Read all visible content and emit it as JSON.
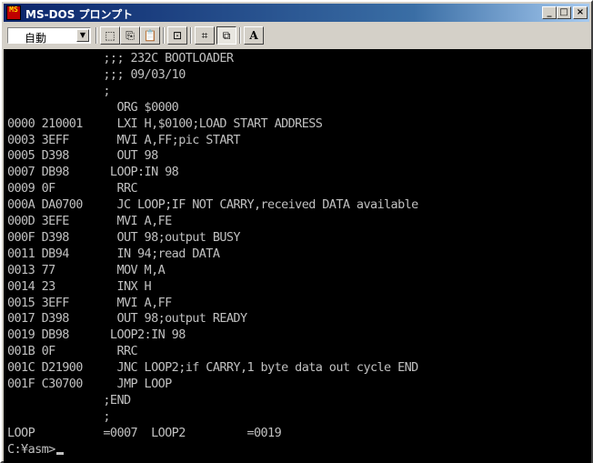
{
  "window": {
    "title": "MS-DOS プロンプト",
    "icon_text": "MS",
    "controls": {
      "minimize": "_",
      "maximize": "□",
      "close": "×"
    }
  },
  "toolbar": {
    "font_select_value": "自動",
    "font_select_arrow": "▼",
    "tools": [
      {
        "name": "mark-tool-icon",
        "glyph": "⬚"
      },
      {
        "name": "copy-tool-icon",
        "glyph": "⎘"
      },
      {
        "name": "paste-tool-icon",
        "glyph": "📋"
      },
      {
        "name": "fullscreen-tool-icon",
        "glyph": "⊡"
      },
      {
        "name": "properties-tool-icon",
        "glyph": "⌗"
      },
      {
        "name": "background-tool-icon",
        "glyph": "⧉"
      },
      {
        "name": "font-tool-icon",
        "glyph": "A"
      }
    ]
  },
  "console": {
    "lines": [
      "              ;;; 232C BOOTLOADER",
      "              ;;; 09/03/10",
      "              ;",
      "                ORG $0000",
      "0000 210001     LXI H,$0100;LOAD START ADDRESS",
      "0003 3EFF       MVI A,FF;pic START",
      "0005 D398       OUT 98",
      "0007 DB98      LOOP:IN 98",
      "0009 0F         RRC",
      "000A DA0700     JC LOOP;IF NOT CARRY,received DATA available",
      "000D 3EFE       MVI A,FE",
      "000F D398       OUT 98;output BUSY",
      "0011 DB94       IN 94;read DATA",
      "0013 77         MOV M,A",
      "0014 23         INX H",
      "0015 3EFF       MVI A,FF",
      "0017 D398       OUT 98;output READY",
      "0019 DB98      LOOP2:IN 98",
      "001B 0F         RRC",
      "001C D21900     JNC LOOP2;if CARRY,1 byte data out cycle END",
      "001F C30700     JMP LOOP",
      "              ;END",
      "              ;",
      "LOOP          =0007  LOOP2         =0019",
      "C:¥asm>"
    ]
  }
}
